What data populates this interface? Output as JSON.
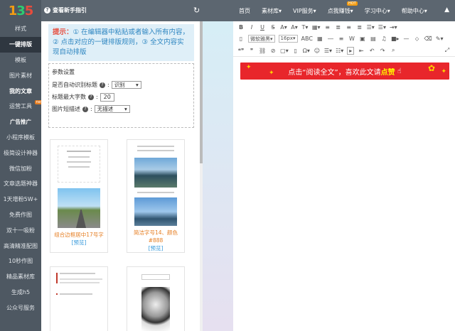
{
  "logo": {
    "text": "135"
  },
  "header": {
    "guide": "查看新手指引",
    "refresh": "↻"
  },
  "nav": [
    "首页",
    "素材库▾",
    "VIP服务▾",
    "点我赚钱▾",
    "学习中心▾",
    "帮助中心▾"
  ],
  "nav_hot": "HOT",
  "sidebar": {
    "items": [
      "样式",
      "一键排版",
      "模板",
      "图片素材",
      "我的文章",
      "运营工具",
      "广告推广",
      "小程序模板",
      "极简设计神器",
      "微信加粉",
      "文章选题神器",
      "1天增粉5W+",
      "免费作图",
      "双十一吸粉",
      "高清精准配图",
      "10秒作图",
      "精品素材库",
      "生成h5",
      "公众号服务"
    ],
    "new_badge": "new"
  },
  "tip": {
    "label": "提示：",
    "text": "① 在编辑器中粘贴或者输入所有内容，② 点击对应的一键排版规则，③ 全文内容实现自动排版"
  },
  "params": {
    "title": "参数设置",
    "auto_title_label": "是否自动识别标题",
    "auto_title_value": "识别",
    "max_title_label": "标题最大字数",
    "max_title_value": "20",
    "img_desc_label": "图片短描述",
    "img_desc_value": "无描述"
  },
  "cards": [
    {
      "title": "组合边框居中17号字",
      "preview": "[预览]"
    },
    {
      "title": "简洁字号14、颜色#888",
      "preview": "[预览]"
    }
  ],
  "toolbar": {
    "font": "微软雅黑",
    "size": "16px"
  },
  "banner": {
    "pre": "点击“阅读全文”，喜欢此文请",
    "bold": "点赞"
  }
}
